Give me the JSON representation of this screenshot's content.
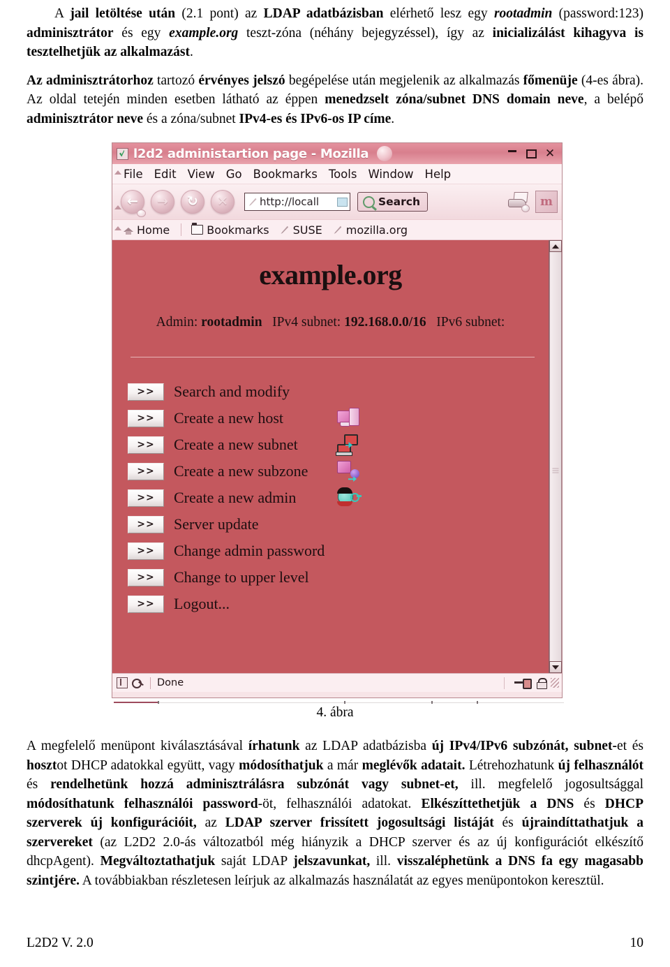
{
  "document": {
    "paragraph_1_html": "A <b>jail letöltése után</b> (2.1 pont) az <b>LDAP adatbázisban</b> elérhető lesz egy <i><b>rootadmin</b></i> (password:123) <b>adminisztrátor</b> és egy <i><b>example.org</b></i> teszt-zóna (néhány bejegyzéssel), így az <b>inicializálást kihagyva is tesztelhetjük az alkalmazást</b>.",
    "paragraph_2_html": "<b>Az adminisztrátorhoz</b> tartozó <b>érvényes jelszó</b> begépelése után megjelenik az alkalmazás <b>főmenüje</b> (4-es ábra). Az oldal tetején minden esetben látható az éppen <b>menedzselt zóna/subnet DNS domain neve</b>, a belépő <b>adminisztrátor neve</b> és a zóna/subnet <b>IPv4-es és IPv6-os IP címe</b>.",
    "figure_caption": "4. ábra",
    "paragraph_3_html": "A megfelelő menüpont kiválasztásával <b>írhatunk</b> az LDAP adatbázisba <b>új IPv4/IPv6 subzónát, subnet-</b>et és <b>hoszt</b>ot DHCP adatokkal együtt, vagy <b>módosíthatjuk</b> a már <b>meglévők adatait.</b> Létrehozhatunk <b>új felhasználót</b> és <b>rendelhetünk hozzá adminisztrálásra subzónát vagy subnet-et,</b> ill. megfelelő jogosultsággal <b>módosíthatunk felhasználói password</b>-öt, felhasználói adatokat. <b>Elkészíttethetjük a DNS</b> és <b>DHCP szerverek új konfigurációit,</b> az <b>LDAP szerver frissített jogosultsági listáját</b> és <b>újraindíttathatjuk a szervereket</b> (az L2D2 2.0-ás változatból még hiányzik a DHCP szerver és az új konfigurációt elkészítő dhcpAgent). <b>Megváltoztathatjuk</b> saját LDAP <b>jelszavunkat,</b> ill. <b>visszaléphetünk a DNS fa egy magasabb szintjére.</b> A továbbiakban részletesen leírjuk az alkalmazás használatát az egyes menüpontokon keresztül.",
    "footer_left": "L2D2 V. 2.0",
    "footer_right": "10"
  },
  "browser": {
    "window_title": "l2d2 administartion page - Mozilla",
    "window_buttons": {
      "minimize": "_",
      "maximize": "□",
      "close": "✕"
    },
    "menubar": [
      {
        "label": "File"
      },
      {
        "label": "Edit"
      },
      {
        "label": "View"
      },
      {
        "label": "Go"
      },
      {
        "label": "Bookmarks"
      },
      {
        "label": "Tools"
      },
      {
        "label": "Window"
      },
      {
        "label": "Help"
      }
    ],
    "toolbar": {
      "back": "←",
      "forward": "→",
      "reload": "↻",
      "stop": "✕",
      "url_value": "http://locall",
      "search_label": "Search"
    },
    "bookmarks": [
      {
        "label": "Home",
        "icon": "home-icon"
      },
      {
        "label": "Bookmarks",
        "icon": "folder-icon"
      },
      {
        "label": "SUSE",
        "icon": "bookmark-pin-icon"
      },
      {
        "label": "mozilla.org",
        "icon": "bookmark-pin-icon"
      }
    ],
    "statusbar": {
      "text": "Done"
    }
  },
  "webpage": {
    "zone_title": "example.org",
    "info_line": {
      "admin_label": "Admin:",
      "admin_value": "rootadmin",
      "ipv4_label": "IPv4 subnet:",
      "ipv4_value": "192.168.0.0/16",
      "ipv6_label": "IPv6 subnet:"
    },
    "background_color": "#c4585e",
    "menu_items": [
      {
        "button": ">>",
        "label": "Search and modify",
        "icon": ""
      },
      {
        "button": ">>",
        "label": "Create a new host",
        "icon": "host-computer-icon"
      },
      {
        "button": ">>",
        "label": "Create a new subnet",
        "icon": "subnet-network-icon"
      },
      {
        "button": ">>",
        "label": "Create a new subzone",
        "icon": "subzone-icon"
      },
      {
        "button": ">>",
        "label": "Create a new admin",
        "icon": "admin-user-icon"
      },
      {
        "button": ">>",
        "label": "Server update",
        "icon": ""
      },
      {
        "button": ">>",
        "label": "Change admin password",
        "icon": ""
      },
      {
        "button": ">>",
        "label": "Change to upper level",
        "icon": ""
      },
      {
        "button": ">>",
        "label": "Logout...",
        "icon": ""
      }
    ]
  }
}
